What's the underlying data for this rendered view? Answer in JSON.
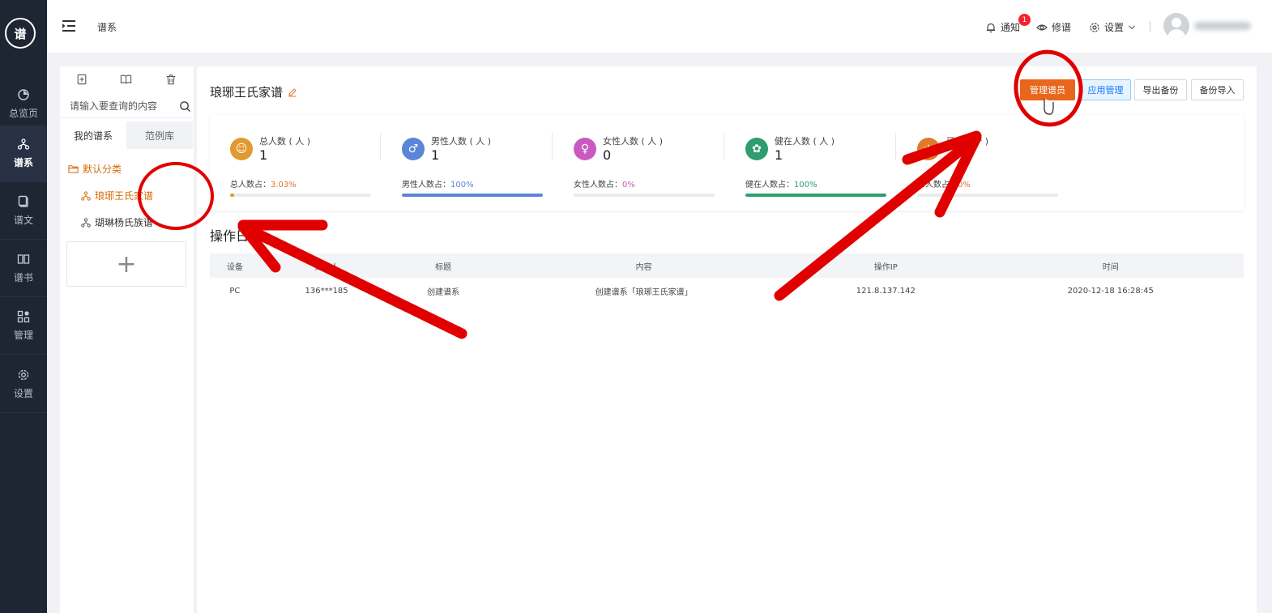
{
  "nav": {
    "logo_text": "谱",
    "items": [
      {
        "label": "总览页",
        "icon": "pie-chart-icon"
      },
      {
        "label": "谱系",
        "icon": "family-tree-icon"
      },
      {
        "label": "谱文",
        "icon": "document-icon"
      },
      {
        "label": "谱书",
        "icon": "book-icon"
      },
      {
        "label": "管理",
        "icon": "grid-icon"
      },
      {
        "label": "设置",
        "icon": "gear-icon"
      }
    ]
  },
  "topbar": {
    "breadcrumb": "谱系",
    "notify_label": "通知",
    "notify_count": "1",
    "edit_label": "修谱",
    "settings_label": "设置"
  },
  "tree": {
    "search_placeholder": "请输入要查询的内容",
    "tab_mine": "我的谱系",
    "tab_examples": "范例库",
    "folder_label": "默认分类",
    "items": [
      "琅琊王氏家谱",
      "瑚琳杨氏族谱"
    ],
    "add_symbol": "+"
  },
  "main": {
    "title": "琅琊王氏家谱",
    "buttons": {
      "manage_admins": "管理谱员",
      "app_manage": "应用管理",
      "export_backup": "导出备份",
      "import_backup": "备份导入"
    },
    "stats": [
      {
        "label": "总人数 ( 人 )",
        "value": "1",
        "pct_label": "总人数占：",
        "pct": "3.03%",
        "fraction": 0.0303,
        "color": "#e09a2f"
      },
      {
        "label": "男性人数 ( 人 )",
        "value": "1",
        "pct_label": "男性人数占：",
        "pct": "100%",
        "fraction": 1.0,
        "color": "#5b85d6"
      },
      {
        "label": "女性人数 ( 人 )",
        "value": "0",
        "pct_label": "女性人数占：",
        "pct": "0%",
        "fraction": 0.0,
        "color": "#c95bc0"
      },
      {
        "label": "健在人数 ( 人 )",
        "value": "1",
        "pct_label": "健在人数占：",
        "pct": "100%",
        "fraction": 1.0,
        "color": "#2e9e6e"
      },
      {
        "label": "已… ( 个 )",
        "value": "",
        "pct_label": "…人数占：",
        "pct": "0%",
        "fraction": 0.0,
        "color": "#e07a2d"
      }
    ],
    "log_title": "操作日志",
    "log_columns": [
      "设备",
      "操作人",
      "标题",
      "内容",
      "操作IP",
      "时间"
    ],
    "log_rows": [
      [
        "PC",
        "136***185",
        "创建谱系",
        "创建谱系「琅琊王氏家谱」",
        "121.8.137.142",
        "2020-12-18 16:28:45"
      ]
    ]
  }
}
